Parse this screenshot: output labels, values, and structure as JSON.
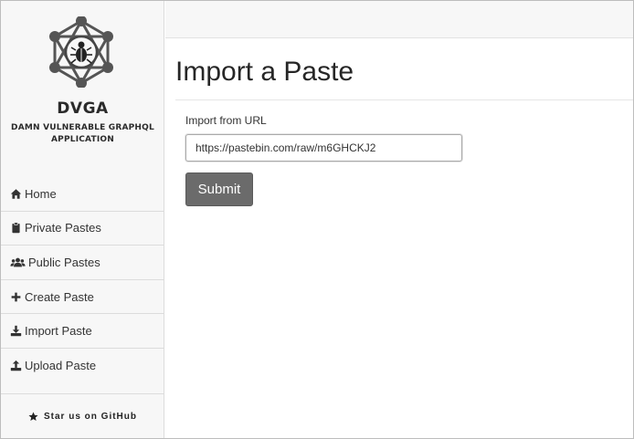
{
  "brand": {
    "title": "DVGA",
    "subtitle": "DAMN VULNERABLE GRAPHQL APPLICATION",
    "logo_icon": "bug-graph-logo"
  },
  "sidebar": {
    "items": [
      {
        "label": "Home",
        "icon": "home-icon"
      },
      {
        "label": "Private Pastes",
        "icon": "clipboard-icon"
      },
      {
        "label": "Public Pastes",
        "icon": "users-icon"
      },
      {
        "label": "Create Paste",
        "icon": "plus-icon"
      },
      {
        "label": "Import Paste",
        "icon": "download-icon"
      },
      {
        "label": "Upload Paste",
        "icon": "upload-icon"
      }
    ],
    "github_label": "Star us on GitHub",
    "github_icon": "star-icon"
  },
  "main": {
    "title": "Import a Paste",
    "form": {
      "label": "Import from URL",
      "url_value": "https://pastebin.com/raw/m6GHCKJ2",
      "submit_label": "Submit"
    }
  },
  "colors": {
    "sidebar_bg": "#f7f7f7",
    "button_bg": "#6b6b6b",
    "text": "#333333"
  }
}
